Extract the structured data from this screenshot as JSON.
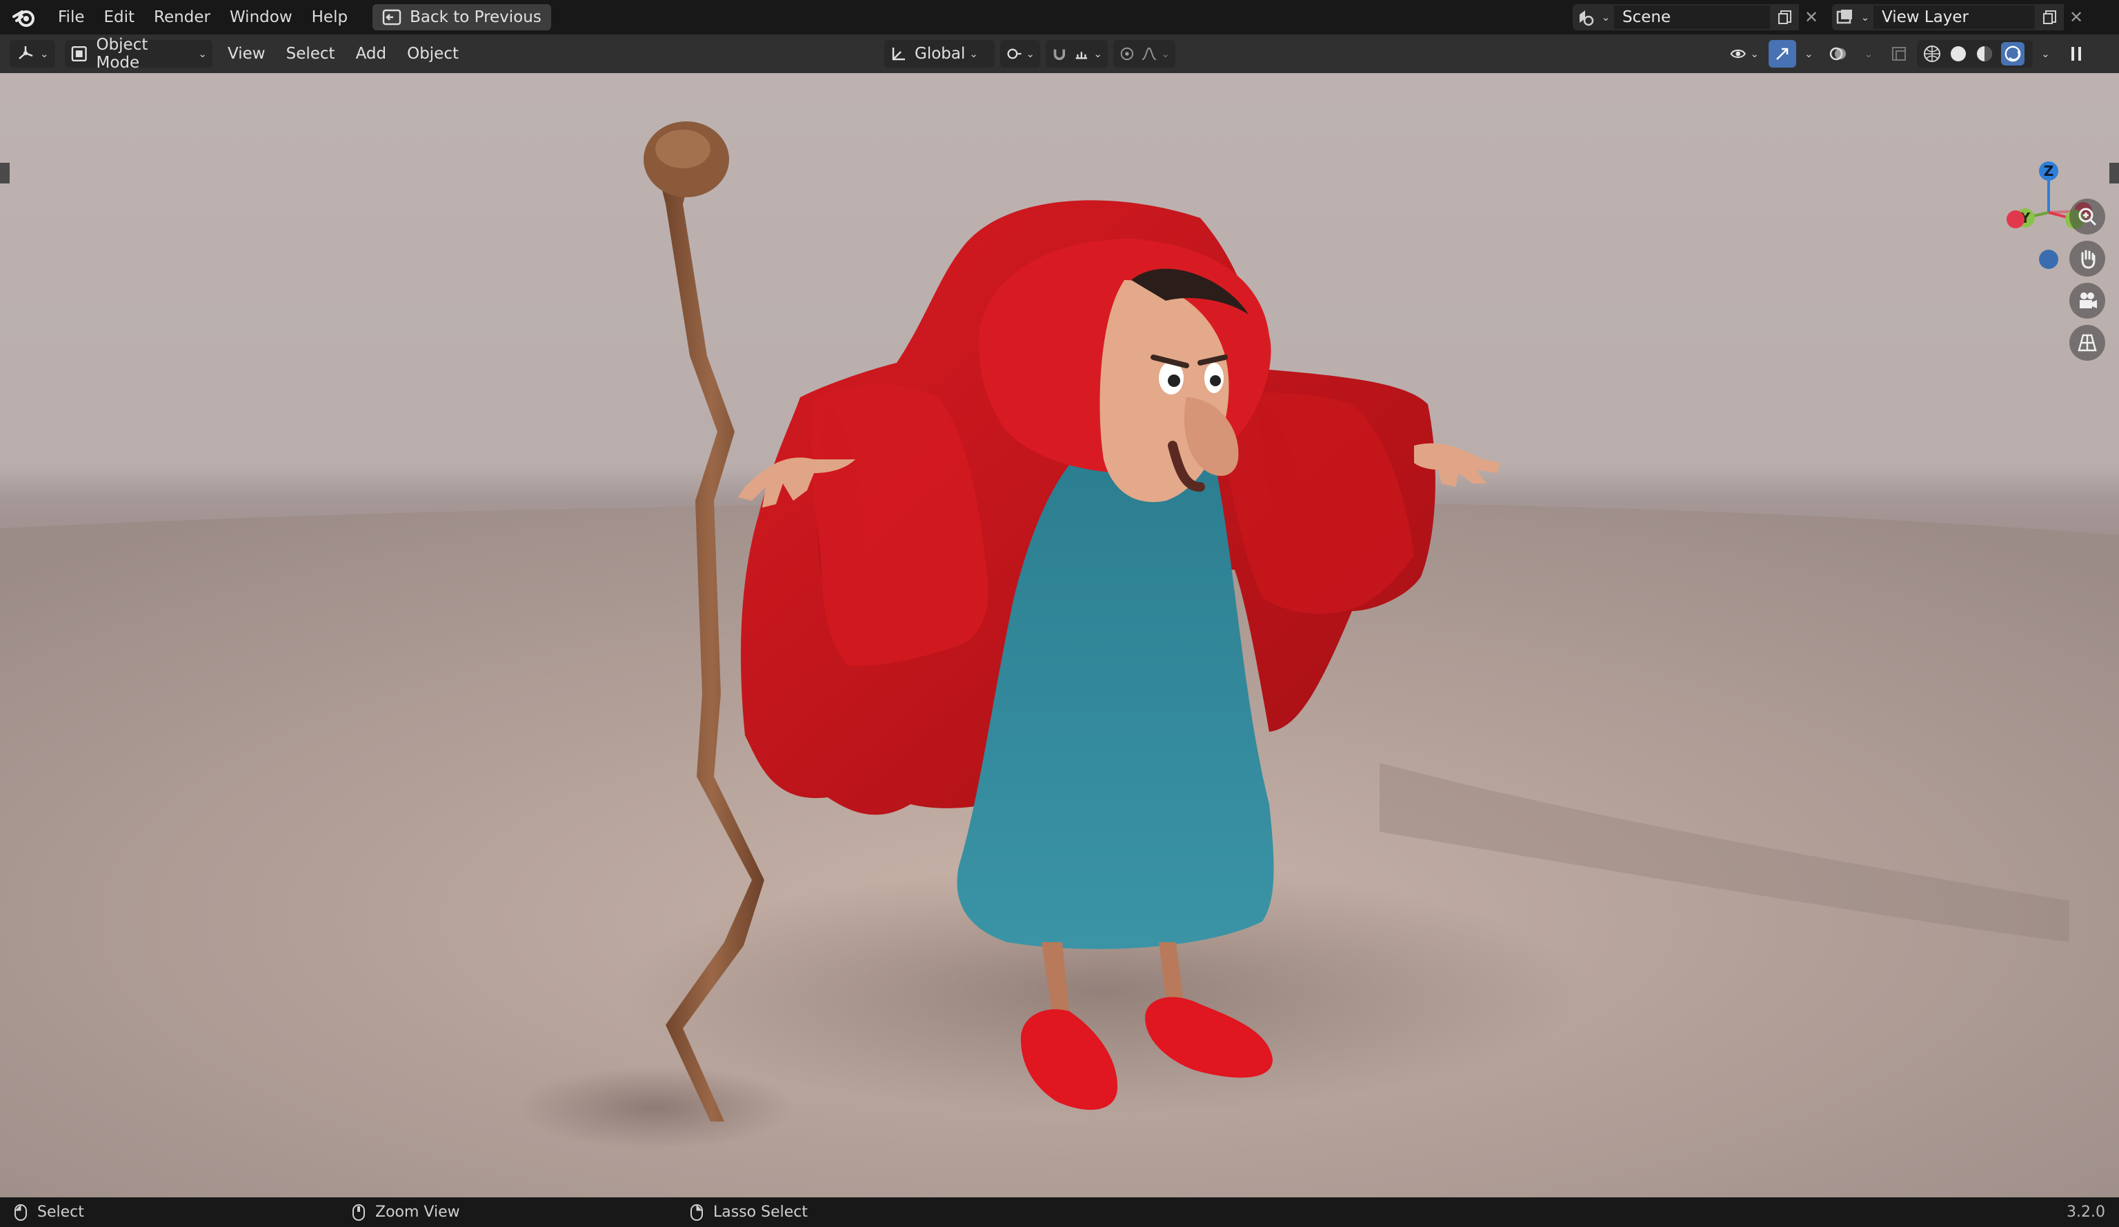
{
  "topbar": {
    "menu": [
      "File",
      "Edit",
      "Render",
      "Window",
      "Help"
    ],
    "back_button": "Back to Previous",
    "scene": "Scene",
    "view_layer": "View Layer"
  },
  "viewport_header": {
    "mode": "Object Mode",
    "menu": [
      "View",
      "Select",
      "Add",
      "Object"
    ],
    "transform_orientation": "Global"
  },
  "gizmo": {
    "axes": [
      "Z",
      "Y",
      "X"
    ]
  },
  "statusbar": {
    "left_mouse": "Select",
    "middle_mouse": "Zoom View",
    "right_mouse": "Lasso Select",
    "version": "3.2.0"
  },
  "colors": {
    "accent_blue": "#4772b3",
    "axis_x": "#e2384e",
    "axis_y": "#8bc34a",
    "axis_z": "#2d7fd9",
    "cloak": "#c9141a",
    "dress": "#2f8a9c",
    "staff": "#8a5a3a"
  }
}
